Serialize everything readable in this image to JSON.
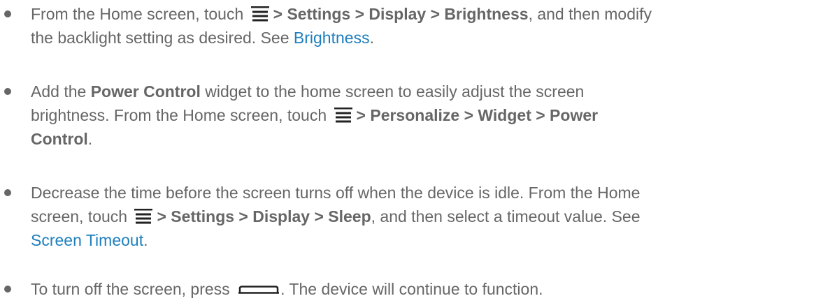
{
  "items": [
    {
      "l1_a": "From the Home screen, touch",
      "l1_path": "> Settings > Display > Brightness",
      "l1_b": ", and then modify",
      "l2_a": "the backlight setting as desired. See ",
      "l2_link": "Brightness",
      "l2_b": "."
    },
    {
      "l1_a": "Add the ",
      "l1_bold": "Power Control",
      "l1_b": " widget to the home screen to easily adjust the screen",
      "l2_a": "brightness. From the Home screen, touch",
      "l2_path": "> Personalize > Widget > Power",
      "l3_bold": "Control",
      "l3_b": "."
    },
    {
      "l1_a": "Decrease the time before the screen turns off when the device is idle. From the Home",
      "l2_a": "screen, touch",
      "l2_path": "> Settings > Display > Sleep",
      "l2_b": ", and then select a timeout value. See",
      "l3_link": "Screen Timeout",
      "l3_b": "."
    },
    {
      "l1_a": "To turn off the screen, press",
      "l1_b": ". The device will continue to function."
    }
  ],
  "icons": {
    "menu": "menu-icon",
    "power_key": "power-key-icon"
  },
  "colors": {
    "text": "#666666",
    "link": "#1e7fbd",
    "icon": "#222222"
  }
}
